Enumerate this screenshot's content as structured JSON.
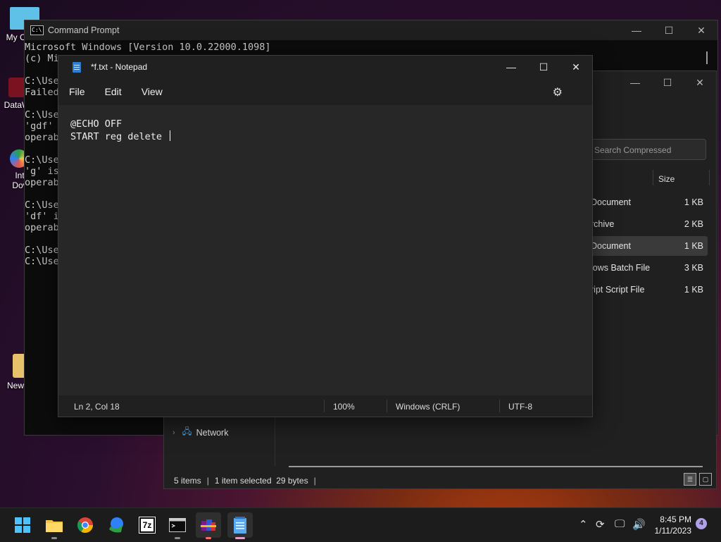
{
  "desktop": {
    "icons": [
      {
        "label": "My Co"
      },
      {
        "label": "DataW"
      },
      {
        "label": "Int"
      },
      {
        "label": "Dov"
      },
      {
        "label": "New"
      }
    ]
  },
  "cmd": {
    "title": "Command Prompt",
    "lines": [
      "Microsoft Windows [Version 10.0.22000.1098]",
      "(c) Mi",
      "",
      "C:\\Use",
      "Failed",
      "",
      "C:\\Use",
      "'gdf'",
      "operab",
      "",
      "C:\\Use",
      "'g' is",
      "operab",
      "",
      "C:\\Use",
      "'df' i",
      "operab",
      "",
      "C:\\Use",
      "C:\\Use"
    ]
  },
  "explorer": {
    "search_placeholder": "Search Compressed",
    "column_size": "Size",
    "rows": [
      {
        "type": "Document",
        "size": "1 KB",
        "selected": false
      },
      {
        "type": "rchive",
        "size": "2 KB",
        "selected": false
      },
      {
        "type": "Document",
        "size": "1 KB",
        "selected": true
      },
      {
        "type": "lows Batch File",
        "size": "3 KB",
        "selected": false
      },
      {
        "type": "ript Script File",
        "size": "1 KB",
        "selected": false
      }
    ],
    "nav_network": "Network",
    "status": {
      "items": "5 items",
      "selected": "1 item selected",
      "bytes": "29 bytes"
    }
  },
  "notepad": {
    "title": "*f.txt - Notepad",
    "menu": {
      "file": "File",
      "edit": "Edit",
      "view": "View"
    },
    "line1": "@ECHO OFF",
    "line2": "START reg delete ",
    "status": {
      "position": "Ln 2, Col 18",
      "zoom": "100%",
      "line_ending": "Windows (CRLF)",
      "encoding": "UTF-8"
    }
  },
  "taskbar": {
    "apps": [
      {
        "name": "start-button-icon",
        "label": ""
      },
      {
        "name": "file-explorer-icon",
        "label": ""
      },
      {
        "name": "chrome-icon",
        "label": ""
      },
      {
        "name": "internet-download-manager-icon",
        "label": ""
      },
      {
        "name": "7zip-icon",
        "label": "7z"
      },
      {
        "name": "terminal-icon",
        "label": ""
      },
      {
        "name": "winrar-icon",
        "label": ""
      },
      {
        "name": "notepad-icon",
        "label": ""
      }
    ],
    "clock": {
      "time": "8:45 PM",
      "date": "1/11/2023"
    },
    "notifications": "4"
  },
  "colors": {
    "accent": "#6cb4ff",
    "taskbar": "#1c1c1c",
    "notepad_bg": "#272727"
  }
}
